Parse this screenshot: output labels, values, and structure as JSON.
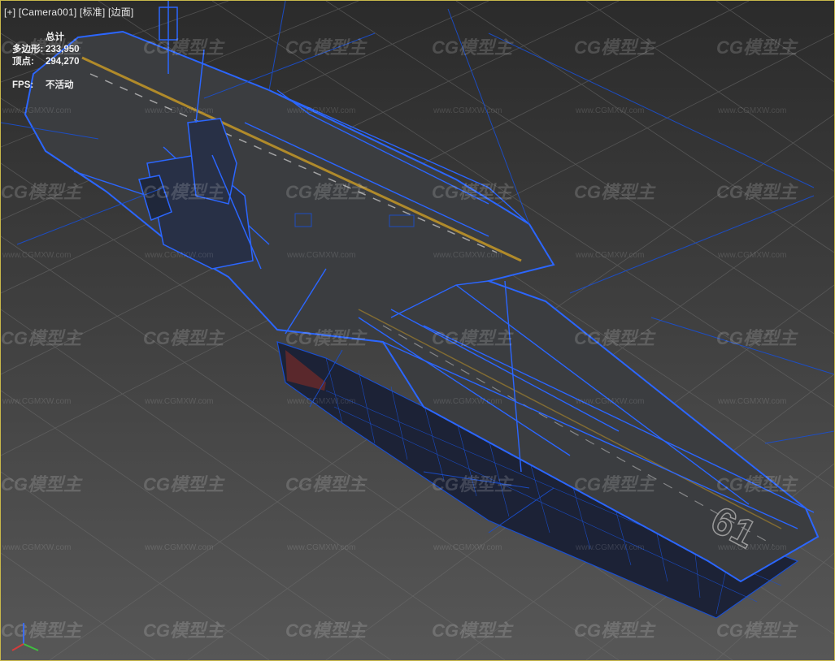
{
  "viewport": {
    "labels": [
      "[+]",
      "[Camera001]",
      "[标准]",
      "[边面]"
    ]
  },
  "stats": {
    "title": "总计",
    "polygons_label": "多边形:",
    "polygons_value": "233,950",
    "vertices_label": "顶点:",
    "vertices_value": "294,270",
    "fps_label": "FPS:",
    "fps_value": "不活动"
  },
  "watermark": {
    "logo": "CG模型主",
    "url": "www.CGMXW.com"
  },
  "hull_number": "61",
  "axis_tripod": [
    "x",
    "y",
    "z"
  ],
  "colors": {
    "wire": "#1a4fd0",
    "wire_bright": "#2b66ff",
    "grid": "#6f6f6f",
    "deck": "#3b3d40",
    "yellow_line": "#b08a2a",
    "viewport_border": "#c9b84a"
  }
}
